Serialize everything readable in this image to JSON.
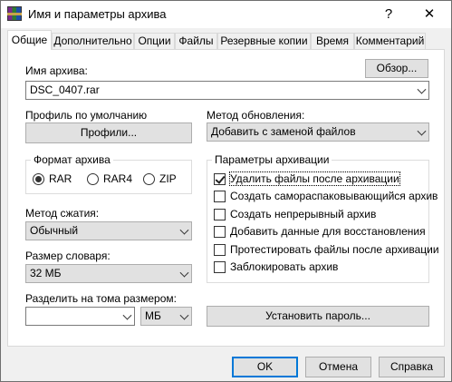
{
  "window": {
    "title": "Имя и параметры архива",
    "help_glyph": "?",
    "close_glyph": "✕"
  },
  "tabs": [
    {
      "label": "Общие",
      "active": true
    },
    {
      "label": "Дополнительно"
    },
    {
      "label": "Опции"
    },
    {
      "label": "Файлы"
    },
    {
      "label": "Резервные копии"
    },
    {
      "label": "Время"
    },
    {
      "label": "Комментарий"
    }
  ],
  "general": {
    "archive_name_label": "Имя архива:",
    "browse_button": "Обзор...",
    "archive_name_value": "DSC_0407.rar",
    "default_profile_label": "Профиль по умолчанию",
    "profiles_button": "Профили...",
    "update_method_label": "Метод обновления:",
    "update_method_value": "Добавить с заменой файлов",
    "archive_format": {
      "title": "Формат архива",
      "options": [
        "RAR",
        "RAR4",
        "ZIP"
      ],
      "selected": "RAR"
    },
    "compression_method_label": "Метод сжатия:",
    "compression_method_value": "Обычный",
    "dictionary_size_label": "Размер словаря:",
    "dictionary_size_value": "32 МБ",
    "split_label": "Разделить на тома размером:",
    "split_value": "",
    "split_unit_value": "МБ",
    "set_password_button": "Установить пароль...",
    "archive_options": {
      "title": "Параметры архивации",
      "items": [
        {
          "label": "Удалить файлы после архивации",
          "checked": true
        },
        {
          "label": "Создать самораспаковывающийся архив",
          "checked": false
        },
        {
          "label": "Создать непрерывный архив",
          "checked": false
        },
        {
          "label": "Добавить данные для восстановления",
          "checked": false
        },
        {
          "label": "Протестировать файлы после архивации",
          "checked": false
        },
        {
          "label": "Заблокировать архив",
          "checked": false
        }
      ]
    }
  },
  "footer": {
    "ok_button": "OK",
    "cancel_button": "Отмена",
    "help_button": "Справка"
  },
  "colors": {
    "focus_border": "#0078d7",
    "dialog_bg": "#f0f0f0"
  }
}
